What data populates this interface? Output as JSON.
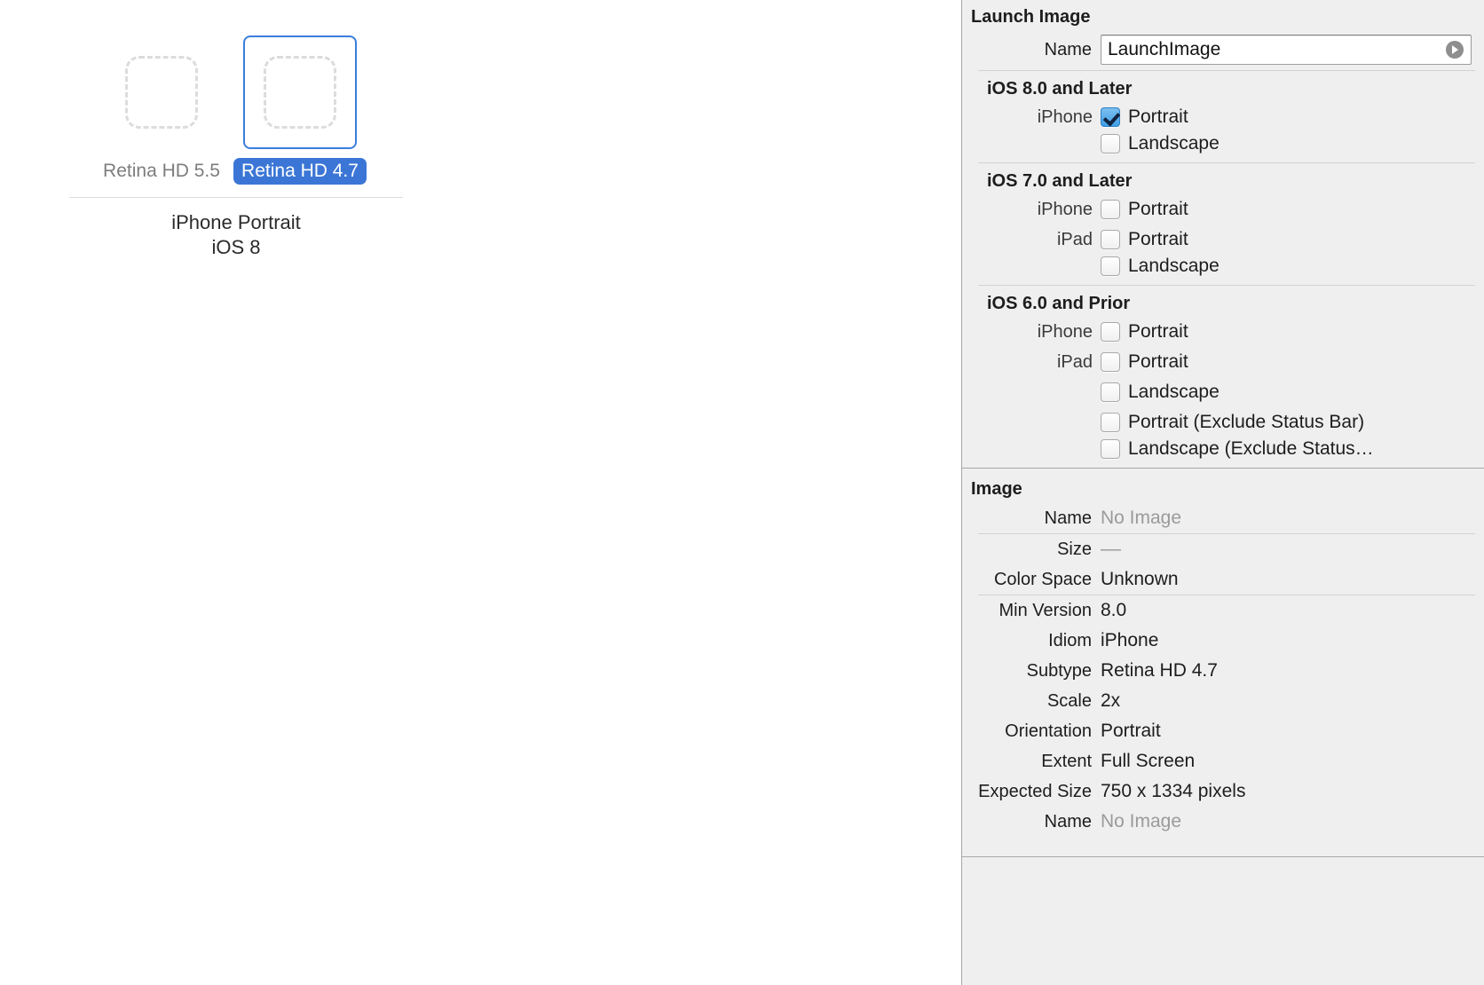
{
  "canvas": {
    "asset_group": {
      "slots": [
        {
          "label": "Retina HD 5.5",
          "selected": false,
          "empty": true
        },
        {
          "label": "Retina HD 4.7",
          "selected": true,
          "empty": true
        }
      ],
      "caption_line1": "iPhone Portrait",
      "caption_line2": "iOS 8"
    }
  },
  "inspector": {
    "launch_image": {
      "title": "Launch Image",
      "name_label": "Name",
      "name_value": "LaunchImage",
      "name_placeholder": "Name",
      "jump_icon": "arrow-right-circle-icon",
      "sections": [
        {
          "heading": "iOS 8.0 and Later",
          "rows": [
            {
              "device": "iPhone",
              "label": "Portrait",
              "checked": true
            },
            {
              "device": "",
              "label": "Landscape",
              "checked": false
            }
          ]
        },
        {
          "heading": "iOS 7.0 and Later",
          "rows": [
            {
              "device": "iPhone",
              "label": "Portrait",
              "checked": false
            },
            {
              "device": "iPad",
              "label": "Portrait",
              "checked": false
            },
            {
              "device": "",
              "label": "Landscape",
              "checked": false
            }
          ]
        },
        {
          "heading": "iOS 6.0 and Prior",
          "rows": [
            {
              "device": "iPhone",
              "label": "Portrait",
              "checked": false
            },
            {
              "device": "iPad",
              "label": "Portrait",
              "checked": false
            },
            {
              "device": "",
              "label": "Landscape",
              "checked": false
            },
            {
              "device": "",
              "label": "Portrait (Exclude Status Bar)",
              "checked": false
            },
            {
              "device": "",
              "label": "Landscape (Exclude Status…",
              "checked": false
            }
          ]
        }
      ]
    },
    "image": {
      "title": "Image",
      "name_label": "Name",
      "name_value": "No Image",
      "size_label": "Size",
      "size_value": "––",
      "color_space_label": "Color Space",
      "color_space_value": "Unknown",
      "attributes": [
        {
          "label": "Min Version",
          "value": "8.0"
        },
        {
          "label": "Idiom",
          "value": "iPhone"
        },
        {
          "label": "Subtype",
          "value": "Retina HD 4.7"
        },
        {
          "label": "Scale",
          "value": "2x"
        },
        {
          "label": "Orientation",
          "value": "Portrait"
        },
        {
          "label": "Extent",
          "value": "Full Screen"
        },
        {
          "label": "Expected Size",
          "value": "750 x 1334 pixels"
        }
      ],
      "bottom_name_label": "Name",
      "bottom_name_value": "No Image"
    }
  },
  "colors": {
    "selection_blue": "#3b76d6",
    "border_blue": "#3b7ddd",
    "panel_bg": "#efefef",
    "muted_text": "#9a9a9a"
  }
}
